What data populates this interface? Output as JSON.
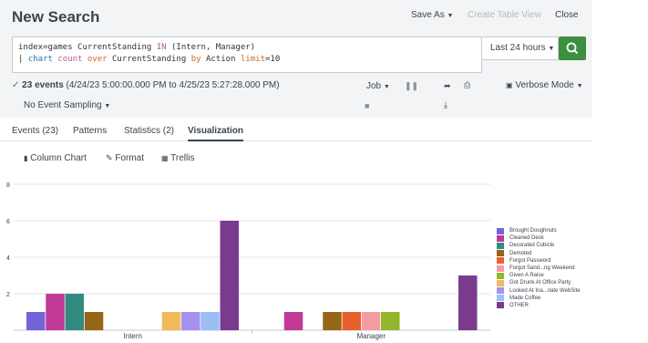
{
  "header": {
    "title": "New Search",
    "save_as": "Save As",
    "create_table_view": "Create Table View",
    "close": "Close"
  },
  "search": {
    "line1_a": "index=games CurrentStanding ",
    "line1_in": "IN",
    "line1_b": " (Intern, Manager)",
    "line2_pipe": "| ",
    "line2_chart": "chart",
    "line2_sp1": " ",
    "line2_count": "count",
    "line2_sp2": " ",
    "line2_over": "over",
    "line2_b": " CurrentStanding ",
    "line2_by": "by",
    "line2_c": " Action ",
    "line2_limit": "limit",
    "line2_d": "=10",
    "time_range": "Last 24 hours",
    "accent": "#3c8f3e"
  },
  "status": {
    "check": "✓",
    "events": "23 events",
    "range": " (4/24/23 5:00:00.000 PM to 4/25/23 5:27:28.000 PM)",
    "sampling": "No Event Sampling",
    "job": "Job",
    "mode": "Verbose Mode"
  },
  "tabs": [
    "Events (23)",
    "Patterns",
    "Statistics (2)",
    "Visualization"
  ],
  "viz_tools": {
    "column_chart": "Column Chart",
    "format": "Format",
    "trellis": "Trellis"
  },
  "chart_data": {
    "type": "bar",
    "categories": [
      "Intern",
      "Manager"
    ],
    "ylim": [
      0,
      8
    ],
    "yticks": [
      "2",
      "4",
      "6",
      "8"
    ],
    "grid": true,
    "legend_position": "right",
    "series": [
      {
        "name": "Brought Doughnuts",
        "color": "#7464d9",
        "values": [
          1,
          0
        ]
      },
      {
        "name": "Cleaned Desk",
        "color": "#c03a96",
        "values": [
          2,
          1
        ]
      },
      {
        "name": "Decorated Cubicle",
        "color": "#338a7f",
        "values": [
          2,
          0
        ]
      },
      {
        "name": "Demoted",
        "color": "#976517",
        "values": [
          1,
          1
        ]
      },
      {
        "name": "Forgot Password",
        "color": "#e8602c",
        "values": [
          0,
          1
        ]
      },
      {
        "name": "Forgot Sand...ng Weekend",
        "color": "#f59ba3",
        "values": [
          0,
          1
        ]
      },
      {
        "name": "Given A Raise",
        "color": "#93b62c",
        "values": [
          0,
          1
        ]
      },
      {
        "name": "Got Drunk At Office Party",
        "color": "#f0b95a",
        "values": [
          1,
          0
        ]
      },
      {
        "name": "Looked At Ina...riate WebSite",
        "color": "#a591f0",
        "values": [
          1,
          0
        ]
      },
      {
        "name": "Made Coffee",
        "color": "#9cbef5",
        "values": [
          1,
          0
        ]
      },
      {
        "name": "OTHER",
        "color": "#7a3b8f",
        "values": [
          6,
          3
        ]
      }
    ]
  }
}
